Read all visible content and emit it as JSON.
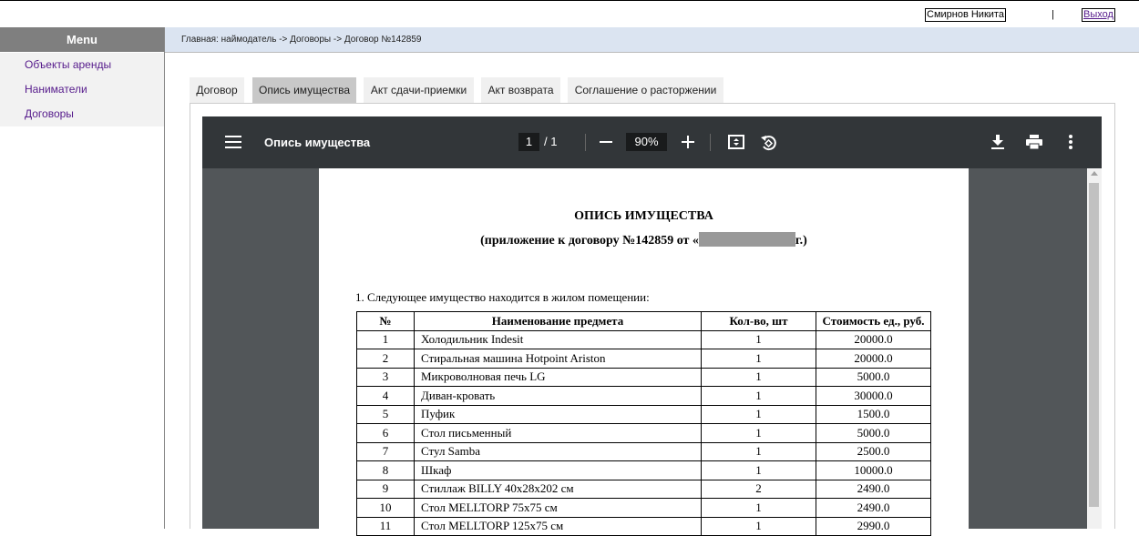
{
  "header": {
    "user_name": "Смирнов Никита",
    "separator": "|",
    "logout_label": "Выход"
  },
  "menu": {
    "title": "Menu",
    "items": [
      {
        "label": "Объекты аренды"
      },
      {
        "label": "Наниматели"
      },
      {
        "label": "Договоры"
      }
    ]
  },
  "breadcrumb": {
    "text": "Главная: наймодатель -> Договоры -> Договор №142859"
  },
  "tabs": [
    {
      "label": "Договор",
      "active": false
    },
    {
      "label": "Опись имущества",
      "active": true
    },
    {
      "label": "Акт сдачи-приемки",
      "active": false
    },
    {
      "label": "Акт возврата",
      "active": false
    },
    {
      "label": "Соглашение о расторжении",
      "active": false
    }
  ],
  "viewer": {
    "title": "Опись имущества",
    "page_current": "1",
    "page_total": "/  1",
    "zoom": "90%",
    "icons": [
      "menu-icon",
      "zoom-out-icon",
      "zoom-in-icon",
      "fit-page-icon",
      "rotate-icon",
      "download-icon",
      "print-icon",
      "more-vert-icon"
    ]
  },
  "document": {
    "title": "ОПИСЬ ИМУЩЕСТВА",
    "subtitle_before": "(приложение к договору №142859 от «",
    "subtitle_after": "г.)",
    "intro": "1. Следующее имущество находится в жилом помещении:",
    "columns": [
      "№",
      "Наименование предмета",
      "Кол-во, шт",
      "Стоимость ед., руб."
    ],
    "rows": [
      [
        "1",
        "Холодильник Indesit",
        "1",
        "20000.0"
      ],
      [
        "2",
        "Стиральная машина Hotpoint Ariston",
        "1",
        "20000.0"
      ],
      [
        "3",
        "Микроволновая печь LG",
        "1",
        "5000.0"
      ],
      [
        "4",
        "Диван-кровать",
        "1",
        "30000.0"
      ],
      [
        "5",
        "Пуфик",
        "1",
        "1500.0"
      ],
      [
        "6",
        "Стол письменный",
        "1",
        "5000.0"
      ],
      [
        "7",
        "Стул Samba",
        "1",
        "2500.0"
      ],
      [
        "8",
        "Шкаф",
        "1",
        "10000.0"
      ],
      [
        "9",
        "Стиллаж BILLY 40x28x202 см",
        "2",
        "2490.0"
      ],
      [
        "10",
        "Стол MELLTORP 75x75 см",
        "1",
        "2490.0"
      ],
      [
        "11",
        "Стол MELLTORP 125x75 см",
        "1",
        "2990.0"
      ]
    ]
  },
  "colors": {
    "menu_header": "#7f7f7f",
    "breadcrumb_bg": "#dbe4f1",
    "active_tab": "#c8c8c8",
    "viewer_toolbar": "#323639",
    "viewer_bg": "#525659",
    "link": "#551a8b"
  }
}
